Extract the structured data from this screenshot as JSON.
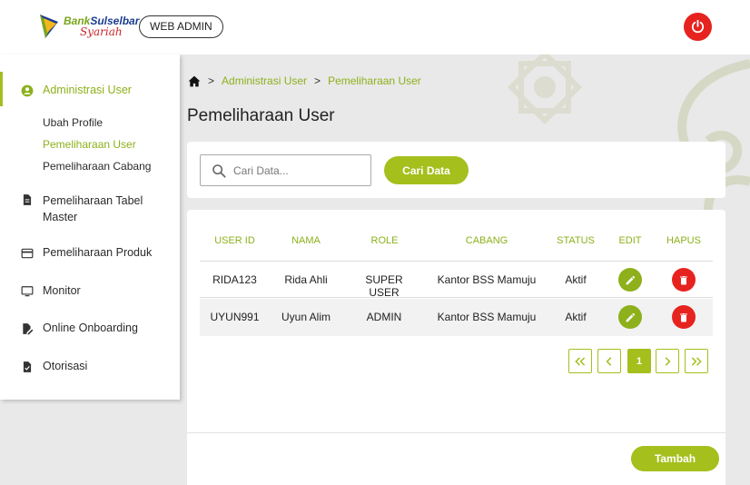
{
  "header": {
    "brand_bank": "Bank",
    "brand_name": "Sulselbar",
    "brand_sub": "Syariah",
    "badge": "WEB ADMIN"
  },
  "sidebar": {
    "items": [
      {
        "label": "Administrasi User",
        "icon": "account-circle-icon",
        "active": true
      },
      {
        "label": "Pemeliharaan Tabel Master",
        "icon": "document-icon"
      },
      {
        "label": "Pemeliharaan Produk",
        "icon": "card-icon"
      },
      {
        "label": "Monitor",
        "icon": "monitor-icon"
      },
      {
        "label": "Online Onboarding",
        "icon": "edit-document-icon"
      },
      {
        "label": "Otorisasi",
        "icon": "approve-document-icon"
      }
    ],
    "subitems": [
      {
        "label": "Ubah Profile"
      },
      {
        "label": "Pemeliharaan User",
        "active": true
      },
      {
        "label": "Pemeliharaan Cabang"
      }
    ]
  },
  "breadcrumb": {
    "home_icon": "home-icon",
    "items": [
      "Administrasi User",
      "Pemeliharaan User"
    ]
  },
  "page": {
    "title": "Pemeliharaan User"
  },
  "search": {
    "placeholder": "Cari Data...",
    "value": "",
    "button": "Cari Data"
  },
  "table": {
    "columns": [
      "USER ID",
      "NAMA",
      "ROLE",
      "CABANG",
      "STATUS",
      "EDIT",
      "HAPUS"
    ],
    "rows": [
      {
        "user_id": "RIDA123",
        "nama": "Rida Ahli",
        "role": "SUPER USER",
        "cabang": "Kantor BSS Mamuju",
        "status": "Aktif"
      },
      {
        "user_id": "UYUN991",
        "nama": "Uyun Alim",
        "role": "ADMIN",
        "cabang": "Kantor BSS Mamuju",
        "status": "Aktif"
      }
    ]
  },
  "pagination": {
    "current_page": "1"
  },
  "actions": {
    "add": "Tambah"
  },
  "colors": {
    "accent": "#a5bf1d",
    "danger": "#e6231f"
  }
}
